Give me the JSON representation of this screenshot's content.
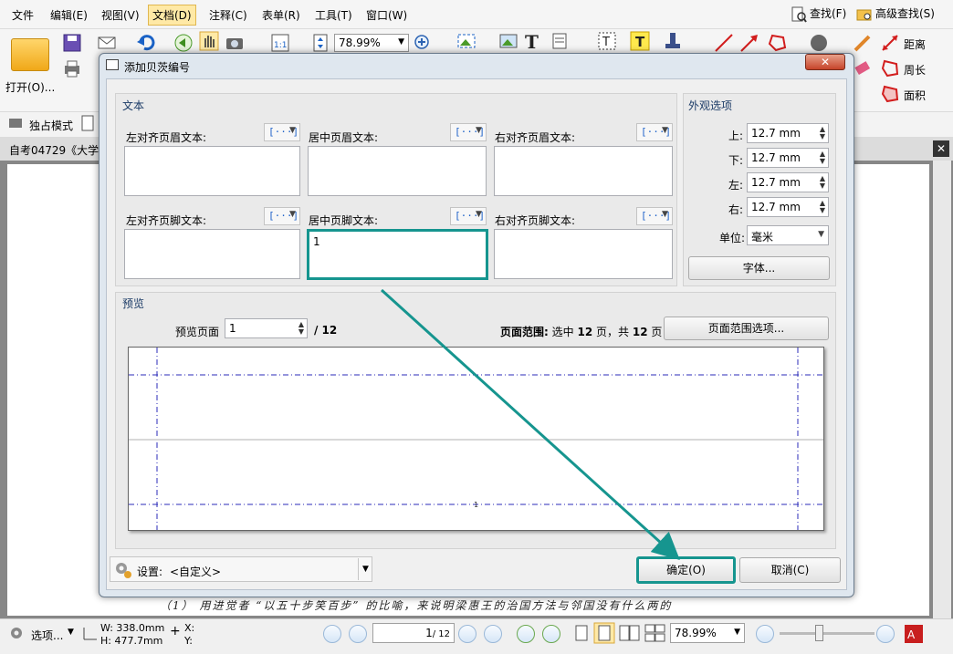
{
  "menu": {
    "items": [
      "文件",
      "编辑(E)",
      "视图(V)",
      "文档(D)",
      "注释(C)",
      "表单(R)",
      "工具(T)",
      "窗口(W)"
    ],
    "active_index": 3,
    "find": "查找(F)",
    "advanced_find": "高级查找(S)"
  },
  "toolbar": {
    "open_label": "打开(O)...",
    "zoom": "78.99%",
    "measure": {
      "distance": "距离",
      "perimeter": "周长",
      "area": "面积"
    }
  },
  "modebar": {
    "exclusive_mode": "独占模式"
  },
  "doc_tab": {
    "title": "自考04729《大学"
  },
  "doc": {
    "handwritten_line": "（1） 用进觉者 “以五十步笑百步” 的比喻，来说明梁惠王的治国方法与邻国没有什么两的"
  },
  "dialog": {
    "title": "添加贝茨编号",
    "text_section": {
      "title": "文本",
      "macro_button": "[···]",
      "fields": [
        {
          "label": "左对齐页眉文本:",
          "value": ""
        },
        {
          "label": "居中页眉文本:",
          "value": ""
        },
        {
          "label": "右对齐页眉文本:",
          "value": ""
        },
        {
          "label": "左对齐页脚文本:",
          "value": ""
        },
        {
          "label": "居中页脚文本:",
          "value": "1"
        },
        {
          "label": "右对齐页脚文本:",
          "value": ""
        }
      ]
    },
    "appearance": {
      "title": "外观选项",
      "margins": [
        {
          "label": "上:",
          "value": "12.7 mm"
        },
        {
          "label": "下:",
          "value": "12.7 mm"
        },
        {
          "label": "左:",
          "value": "12.7 mm"
        },
        {
          "label": "右:",
          "value": "12.7 mm"
        }
      ],
      "unit_label": "单位:",
      "unit_value": "毫米",
      "font_button": "字体..."
    },
    "preview": {
      "title": "预览",
      "page_label": "预览页面",
      "page_value": "1",
      "page_total": "/ 12",
      "range_label": "页面范围:",
      "range_text_pre": "选中",
      "range_selected": "12",
      "range_text_mid": "页，共",
      "range_total": "12",
      "range_text_post": "页",
      "range_button": "页面范围选项...",
      "footer_sample": "1"
    },
    "settings": {
      "label": "设置:",
      "value": "<自定义>"
    },
    "ok_button": "确定(O)",
    "cancel_button": "取消(C)"
  },
  "statusbar": {
    "options": "选项...",
    "width": "W: 338.0mm",
    "height": "H: 477.7mm",
    "x": "X:",
    "y": "Y:",
    "page_current": "1",
    "page_total": "/ 12",
    "zoom": "78.99%"
  },
  "colors": {
    "highlight": "#16958f",
    "accent_menu": "#ffe9a6",
    "guide_lines": "#2b2bb8"
  }
}
